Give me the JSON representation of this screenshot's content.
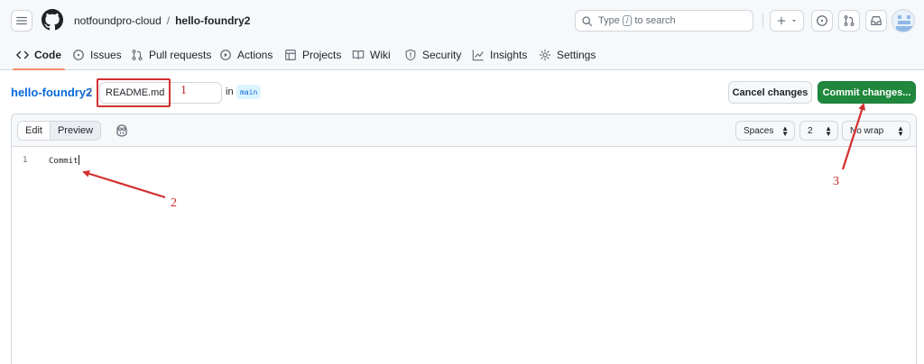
{
  "header": {
    "owner": "notfoundpro-cloud",
    "separator": "/",
    "repo": "hello-foundry2",
    "search": {
      "prefix": "Type",
      "key": "/",
      "suffix": "to search"
    }
  },
  "tabs": [
    {
      "label": "Code",
      "icon": "code-icon",
      "active": true
    },
    {
      "label": "Issues",
      "icon": "issue-icon"
    },
    {
      "label": "Pull requests",
      "icon": "pull-request-icon"
    },
    {
      "label": "Actions",
      "icon": "play-icon"
    },
    {
      "label": "Projects",
      "icon": "table-icon"
    },
    {
      "label": "Wiki",
      "icon": "book-icon"
    },
    {
      "label": "Security",
      "icon": "shield-icon"
    },
    {
      "label": "Insights",
      "icon": "graph-icon"
    },
    {
      "label": "Settings",
      "icon": "gear-icon"
    }
  ],
  "edit": {
    "repo_link": "hello-foundry2",
    "slash": "/",
    "filename": "README.md",
    "in_label": "in",
    "branch": "main",
    "cancel_label": "Cancel changes",
    "commit_label": "Commit changes..."
  },
  "editor": {
    "tab_edit": "Edit",
    "tab_preview": "Preview",
    "indent_mode": "Spaces",
    "indent_size": "2",
    "wrap_mode": "No wrap",
    "line_number": "1",
    "line_content": "Commit"
  },
  "annotations": {
    "one": "1",
    "two": "2",
    "three": "3",
    "color": "#d32f2f"
  },
  "colors": {
    "accent_link": "#0969da",
    "commit_green": "#1f883d",
    "active_tab_underline": "#fd8c73"
  }
}
